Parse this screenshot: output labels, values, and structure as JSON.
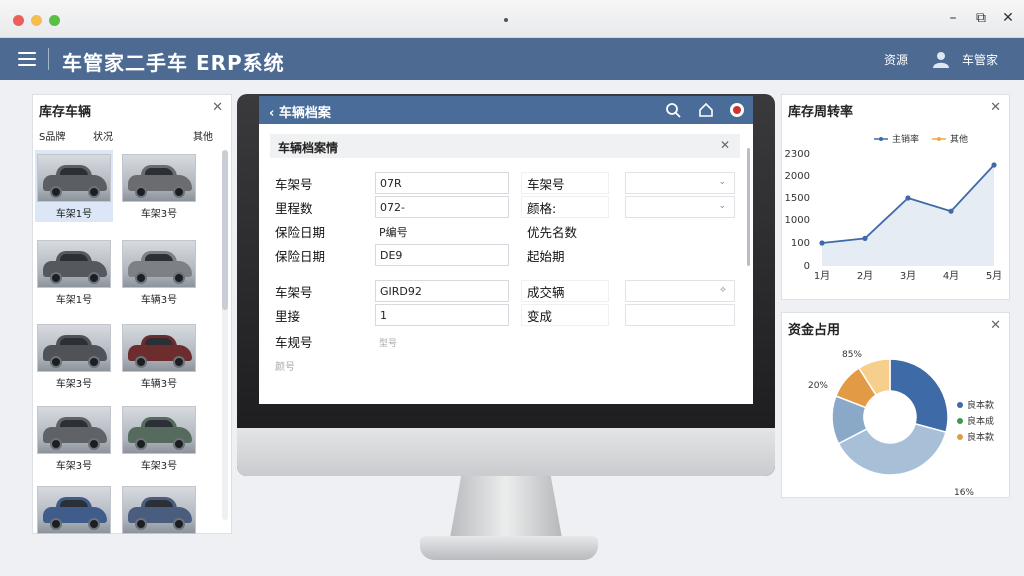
{
  "window": {
    "minimize": "–",
    "maximize": "⧉",
    "close": "✕"
  },
  "app": {
    "title": "车管家二手车 ERP系统",
    "right_text": "资源",
    "user_name": "车管家"
  },
  "inventory": {
    "title": "库存车辆",
    "tabs": [
      "S品牌",
      "状况",
      "其他"
    ],
    "cars": [
      {
        "label": "车架1号",
        "color": "#5b5e63"
      },
      {
        "label": "车架3号",
        "color": "#6a6c70"
      },
      {
        "label": "车架1号",
        "color": "#55585d"
      },
      {
        "label": "车辆3号",
        "color": "#7d8085"
      },
      {
        "label": "车架3号",
        "color": "#4f5257"
      },
      {
        "label": "车辆3号",
        "color": "#6d2d2e"
      },
      {
        "label": "车架3号",
        "color": "#5f6267"
      },
      {
        "label": "车架3号",
        "color": "#566b5e"
      },
      {
        "label": "",
        "color": "#3f5c8a"
      },
      {
        "label": "",
        "color": "#4a5d7e"
      }
    ]
  },
  "record": {
    "header_title": "车辆档案",
    "back_icon": "chevron-left-icon",
    "panel_title": "车辆档案情",
    "left_labels": [
      "车架号",
      "里程数",
      "保险日期",
      "保险日期",
      "车架号",
      "里接",
      "车规号",
      "颜号"
    ],
    "left_values": [
      "07R",
      "072-",
      "P编号",
      "DE9",
      "GIRD92",
      "1",
      "型号"
    ],
    "right_labels": [
      "车架号",
      "颜格:",
      "优先名数",
      "起始期",
      "成交辆",
      "变成"
    ]
  },
  "turnover": {
    "title": "库存周转率",
    "legend": [
      "主销率",
      "其他"
    ]
  },
  "capital": {
    "title": "资金占用",
    "labels": [
      "85%",
      "20%",
      "16%"
    ],
    "legend": [
      "良本款",
      "良本成"
    ],
    "legend_third": "良本款"
  },
  "chart_data": [
    {
      "type": "line",
      "title": "库存周转率",
      "x": [
        "1月",
        "2月",
        "3月",
        "4月",
        "5月"
      ],
      "series": [
        {
          "name": "主销率",
          "values": [
            100,
            280,
            1500,
            1200,
            2150
          ]
        }
      ],
      "yticks": [
        "2300",
        "2000",
        "1500",
        "1000",
        "100",
        "0"
      ],
      "legend": [
        "主销率",
        "其他"
      ],
      "colors": {
        "line": "#3e6aa8",
        "other": "#f0a840"
      }
    },
    {
      "type": "pie",
      "title": "资金占用",
      "slices": [
        {
          "name": "良本款",
          "value": 26,
          "color": "#3e6aa8"
        },
        {
          "name": "",
          "value": 34,
          "color": "#a8bfd8"
        },
        {
          "name": "良本成",
          "value": 12,
          "color": "#8aa8c8"
        },
        {
          "name": "",
          "value": 9,
          "color": "#e39a45"
        },
        {
          "name": "",
          "value": 8,
          "color": "#f6cf8c"
        }
      ],
      "labels": [
        "85%",
        "20%",
        "16%"
      ]
    }
  ]
}
